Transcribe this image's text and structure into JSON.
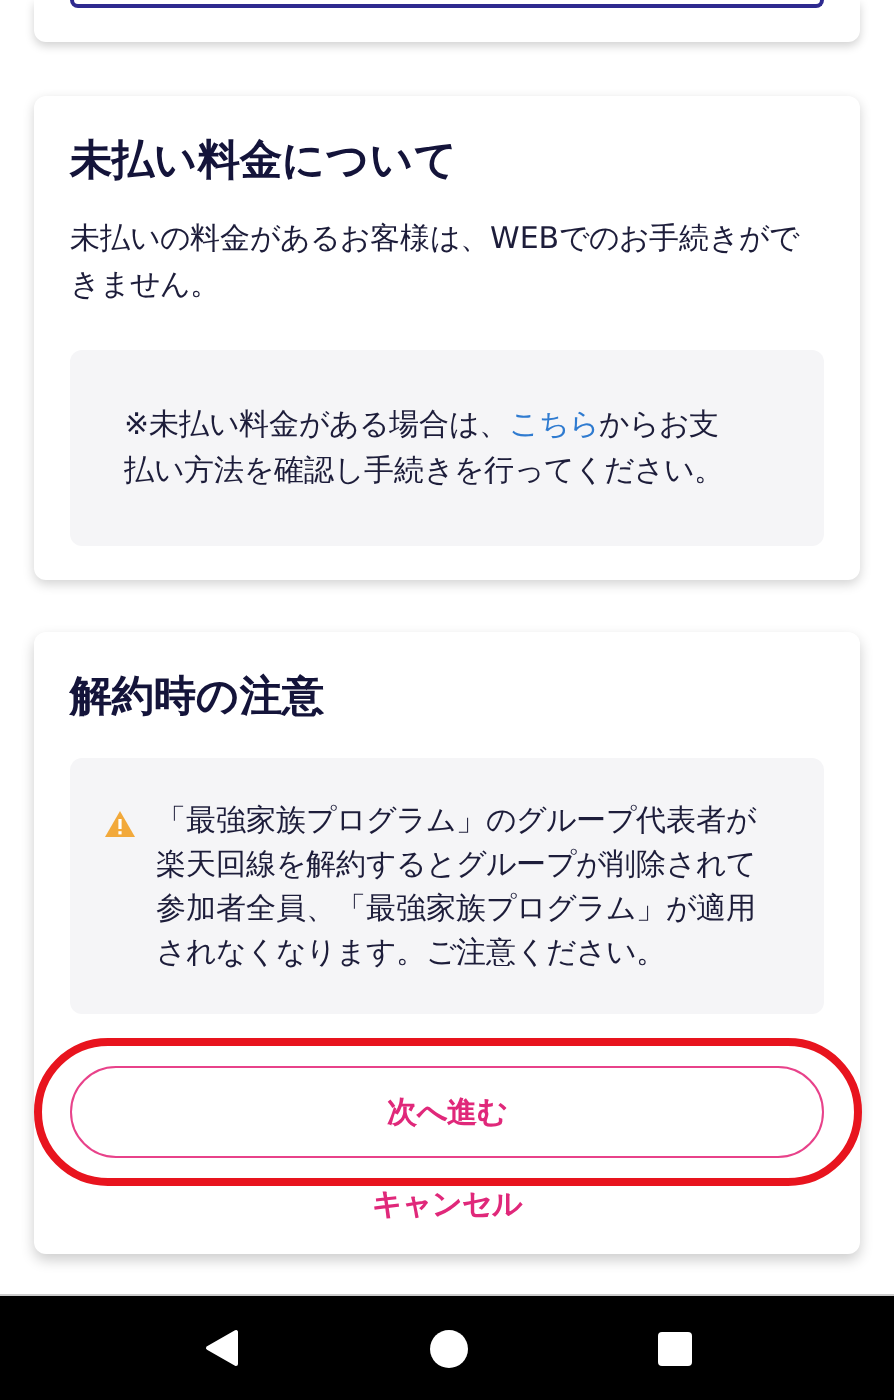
{
  "unpaid_card": {
    "title": "未払い料金について",
    "body": "未払いの料金があるお客様は、WEBでのお手続きができません。",
    "notice": {
      "text_before": "※未払い料金がある場合は、",
      "link": "こちら",
      "text_after": "からお支払い方法を確認し手続きを行ってください。"
    }
  },
  "cancel_card": {
    "title": "解約時の注意",
    "warning": "「最強家族プログラム」のグループ代表者が楽天回線を解約するとグループが削除されて参加者全員、「最強家族プログラム」が適用されなくなります。ご注意ください。",
    "primary_button": "次へ進む",
    "secondary_link": "キャンセル"
  }
}
